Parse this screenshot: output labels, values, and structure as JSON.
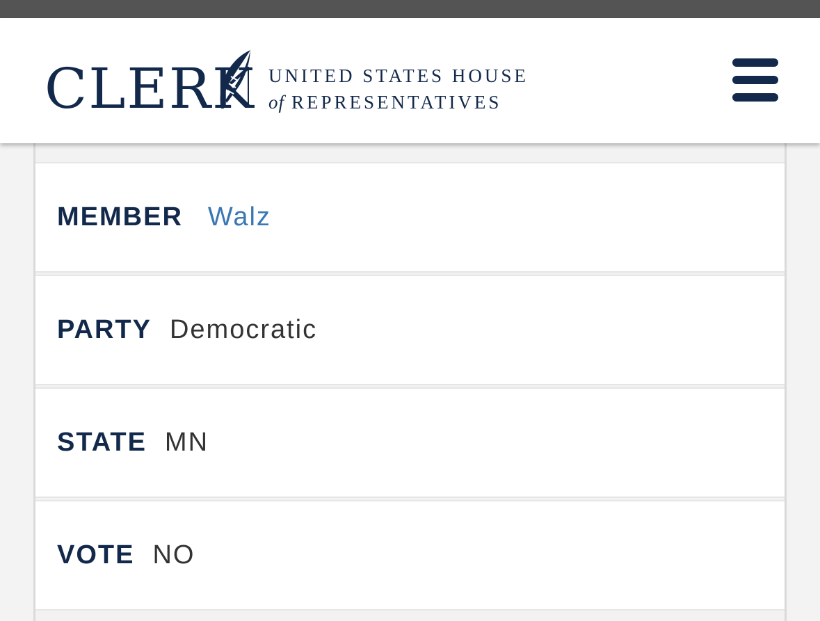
{
  "header": {
    "logo_word": "CLERK",
    "house_line1": "UNITED STATES HOUSE",
    "house_line2_of": "of",
    "house_line2_rest": "REPRESENTATIVES",
    "menu_icon": "hamburger-menu-icon"
  },
  "record": {
    "member_label": "MEMBER",
    "member_value": "Walz",
    "party_label": "PARTY",
    "party_value": "Democratic",
    "state_label": "STATE",
    "state_value": "MN",
    "vote_label": "VOTE",
    "vote_value": "NO"
  },
  "colors": {
    "brand_navy": "#13294b",
    "link_blue": "#3a78b3",
    "top_bar": "#545454"
  }
}
